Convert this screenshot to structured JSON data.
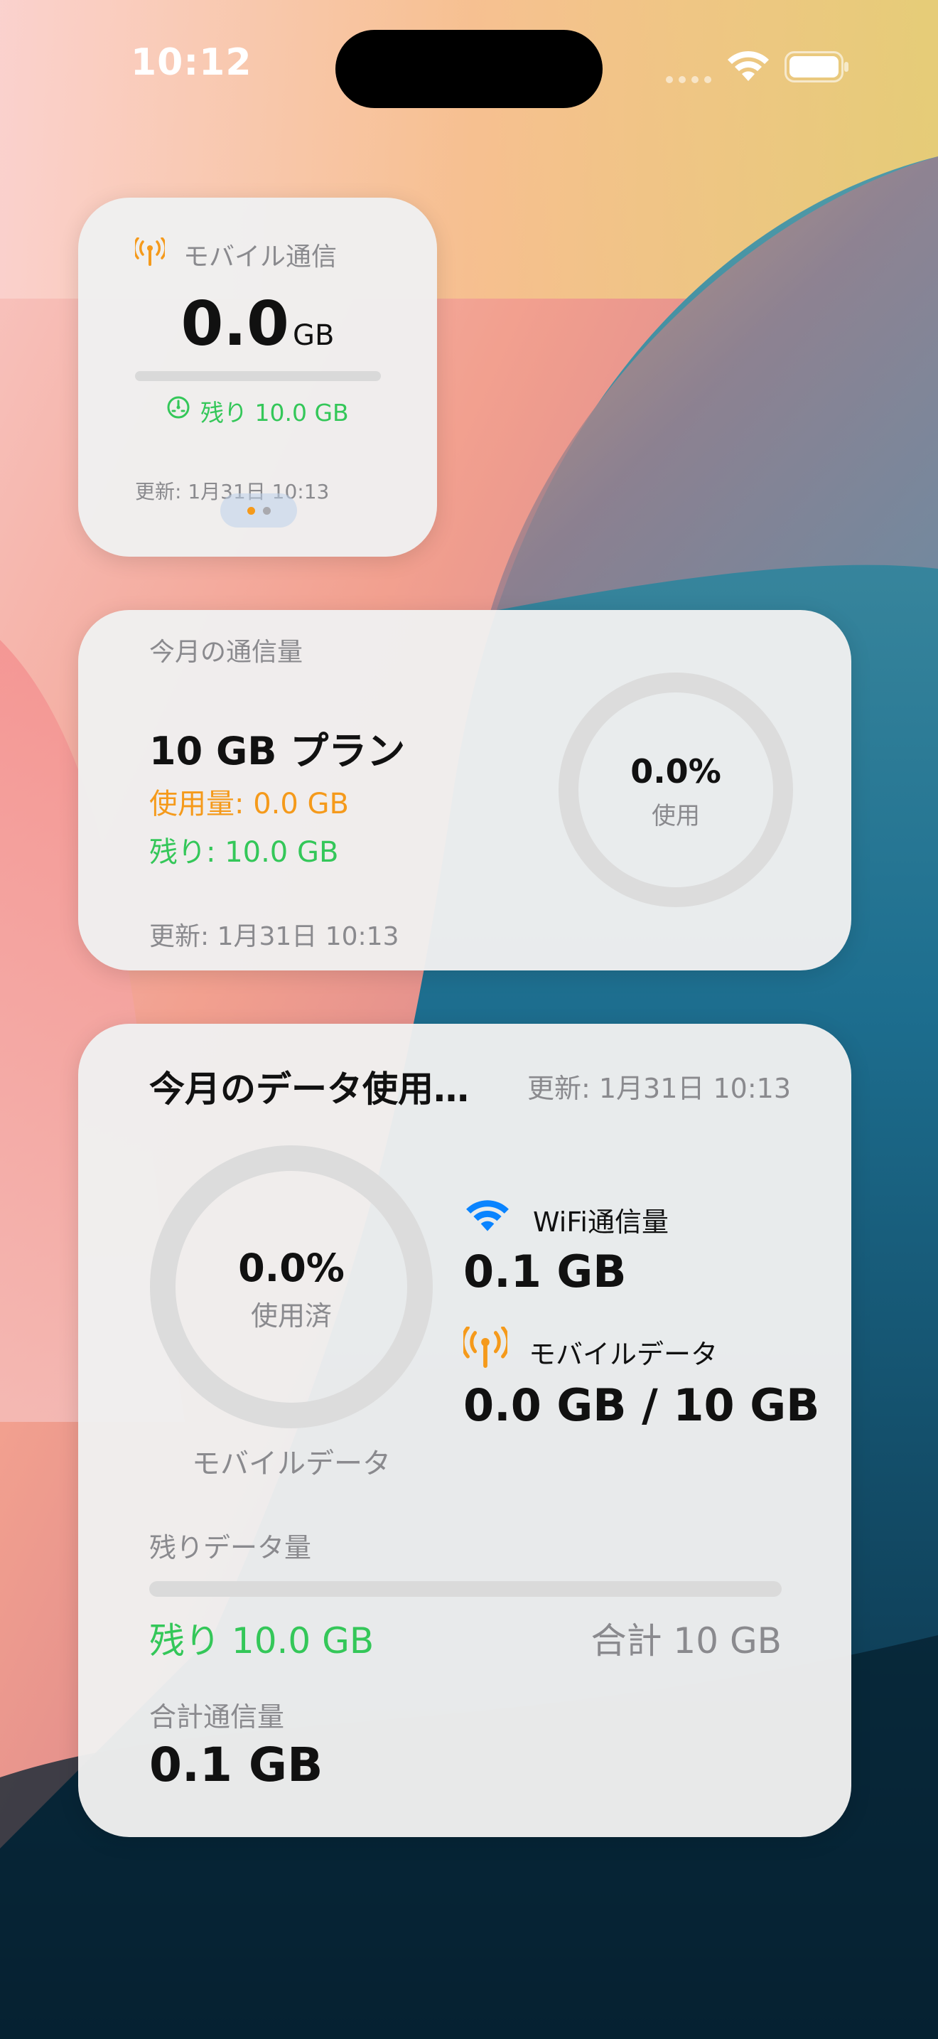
{
  "status_bar": {
    "time": "10:12"
  },
  "small_widget": {
    "title": "モバイル通信",
    "usage_value": "0.0",
    "usage_unit": "GB",
    "remaining_label": "残り 10.0 GB",
    "updated": "更新: 1月31日 10:13",
    "usage_fraction": 0.0
  },
  "medium_widget": {
    "title": "今月の通信量",
    "plan": "10 GB プラン",
    "used": "使用量: 0.0 GB",
    "remaining": "残り: 10.0 GB",
    "updated": "更新: 1月31日 10:13",
    "ring_percent": "0.0%",
    "ring_label": "使用"
  },
  "large_widget": {
    "title": "今月のデータ使用…",
    "updated": "更新: 1月31日 10:13",
    "ring_percent": "0.0%",
    "ring_label": "使用済",
    "ring_caption": "モバイルデータ",
    "wifi_label": "WiFi通信量",
    "wifi_value": "0.1 GB",
    "mobile_label": "モバイルデータ",
    "mobile_value": "0.0 GB / 10 GB",
    "remaining_section_label": "残りデータ量",
    "remaining_value": "残り 10.0 GB",
    "total_plan": "合計 10 GB",
    "total_label": "合計通信量",
    "total_value": "0.1 GB"
  },
  "colors": {
    "accent_orange": "#f59a1b",
    "accent_green": "#34c759",
    "wifi_blue": "#0a84ff"
  }
}
